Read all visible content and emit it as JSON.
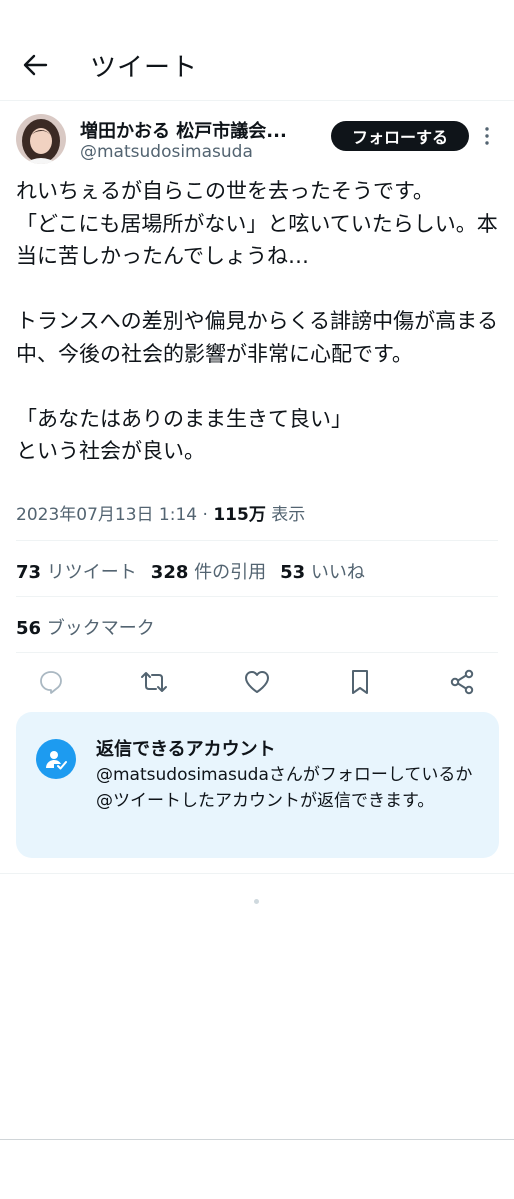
{
  "header": {
    "title": "ツイート",
    "back_icon": "arrow-left-icon"
  },
  "tweet": {
    "author_name": "増田かおる 松戸市議会...",
    "author_handle": "@matsudosimasuda",
    "follow_label": "フォローする",
    "text": "れいちぇるが自らこの世を去ったそうです。\n「どこにも居場所がない」と呟いていたらしい。本当に苦しかったんでしょうね…\n\nトランスへの差別や偏見からくる誹謗中傷が高まる中、今後の社会的影響が非常に心配です。\n\n「あなたはありのまま生きて良い」\nという社会が良い。",
    "date": "2023年07月13日 1:14",
    "separator": "·",
    "views_count": "115万",
    "views_label": "表示"
  },
  "stats": {
    "retweets_count": "73",
    "retweets_label": "リツイート",
    "quotes_count": "328",
    "quotes_label": "件の引用",
    "likes_count": "53",
    "likes_label": "いいね",
    "bookmarks_count": "56",
    "bookmarks_label": "ブックマーク"
  },
  "actions": [
    "reply-icon",
    "retweet-icon",
    "like-icon",
    "bookmark-icon",
    "share-icon"
  ],
  "reply_restriction": {
    "title": "返信できるアカウント",
    "text": "@matsudosimasudaさんがフォローしているか@ツイートしたアカウントが返信できます。"
  },
  "colors": {
    "accent": "#1d9bf0",
    "text": "#0f1419",
    "secondary": "#536471",
    "panel": "#e8f5fd"
  }
}
